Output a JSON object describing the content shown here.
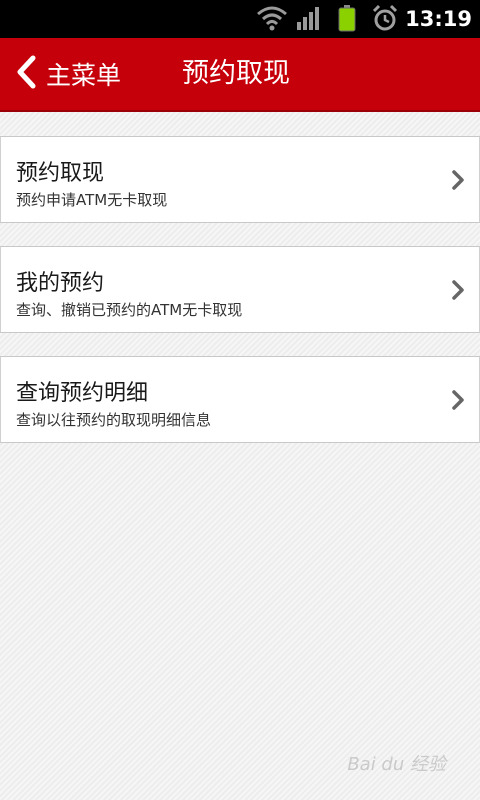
{
  "status_bar": {
    "time": "13:19",
    "icons": [
      "wifi-icon",
      "signal-icon",
      "battery-icon",
      "alarm-icon"
    ]
  },
  "header": {
    "back_label": "主菜单",
    "title": "预约取现"
  },
  "menu": {
    "items": [
      {
        "title": "预约取现",
        "subtitle": "预约申请ATM无卡取现"
      },
      {
        "title": "我的预约",
        "subtitle": "查询、撤销已预约的ATM无卡取现"
      },
      {
        "title": "查询预约明细",
        "subtitle": "查询以往预约的取现明细信息"
      }
    ]
  },
  "watermark": "Bai du 经验",
  "colors": {
    "header": "#c6000b",
    "status_bar": "#000000",
    "battery": "#8bd100"
  }
}
